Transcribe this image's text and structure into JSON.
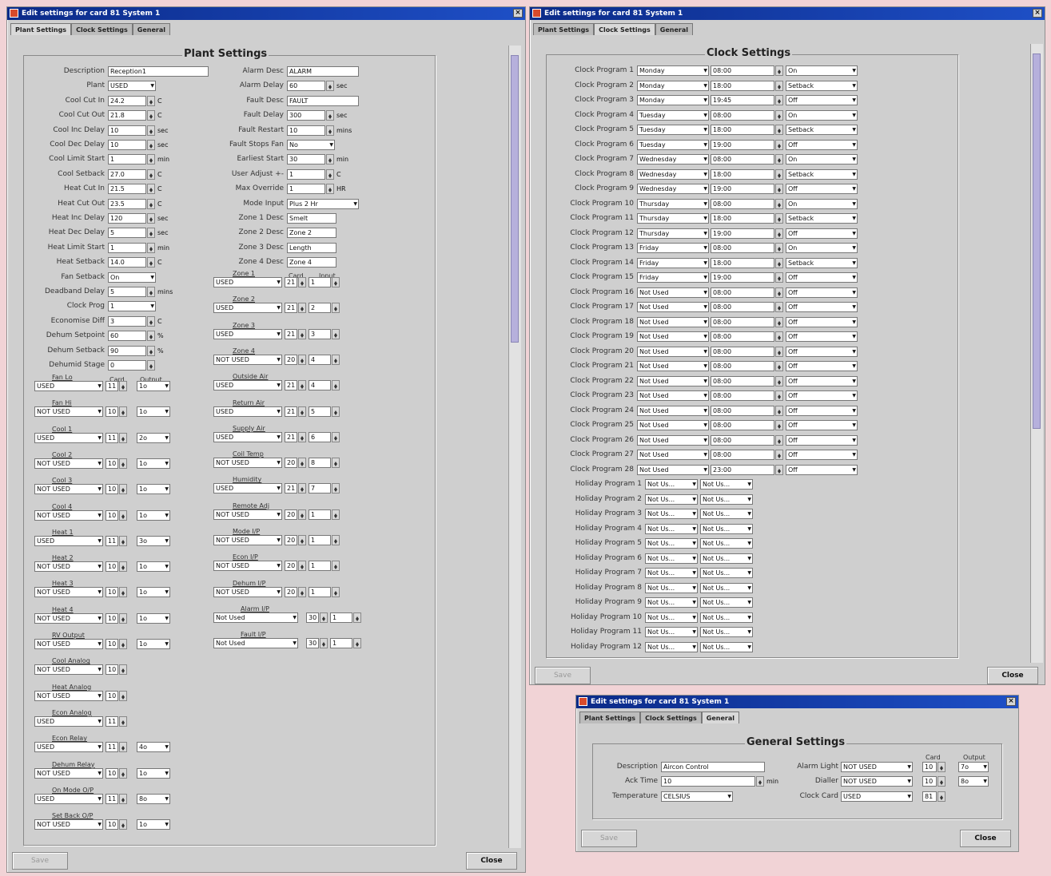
{
  "win1": {
    "title": "Edit settings for card 81 System 1",
    "tabs": [
      "Plant Settings",
      "Clock Settings",
      "General"
    ],
    "panel": "Plant Settings",
    "left": [
      {
        "label": "Description",
        "value": "Reception1",
        "type": "text",
        "w": 126
      },
      {
        "label": "Plant",
        "value": "USED",
        "type": "sel",
        "w": 60
      },
      {
        "label": "Cool Cut In",
        "value": "24.2",
        "type": "spin",
        "w": 48,
        "unit": "C"
      },
      {
        "label": "Cool Cut Out",
        "value": "21.8",
        "type": "spin",
        "w": 48,
        "unit": "C"
      },
      {
        "label": "Cool Inc Delay",
        "value": "10",
        "type": "spin",
        "w": 48,
        "unit": "sec"
      },
      {
        "label": "Cool Dec Delay",
        "value": "10",
        "type": "spin",
        "w": 48,
        "unit": "sec"
      },
      {
        "label": "Cool Limit Start",
        "value": "1",
        "type": "spin",
        "w": 48,
        "unit": "min"
      },
      {
        "label": "Cool Setback",
        "value": "27.0",
        "type": "spin",
        "w": 48,
        "unit": "C"
      },
      {
        "label": "Heat Cut In",
        "value": "21.5",
        "type": "spin",
        "w": 48,
        "unit": "C"
      },
      {
        "label": "Heat Cut Out",
        "value": "23.5",
        "type": "spin",
        "w": 48,
        "unit": "C"
      },
      {
        "label": "Heat Inc Delay",
        "value": "120",
        "type": "spin",
        "w": 48,
        "unit": "sec"
      },
      {
        "label": "Heat Dec Delay",
        "value": "5",
        "type": "spin",
        "w": 48,
        "unit": "sec"
      },
      {
        "label": "Heat Limit Start",
        "value": "1",
        "type": "spin",
        "w": 48,
        "unit": "min"
      },
      {
        "label": "Heat Setback",
        "value": "14.0",
        "type": "spin",
        "w": 48,
        "unit": "C"
      },
      {
        "label": "Fan Setback",
        "value": "On",
        "type": "sel",
        "w": 60
      },
      {
        "label": "Deadband Delay",
        "value": "5",
        "type": "spin",
        "w": 48,
        "unit": "mins"
      },
      {
        "label": "Clock Prog",
        "value": "1",
        "type": "sel",
        "w": 60
      },
      {
        "label": "Economise Diff",
        "value": "3",
        "type": "spin",
        "w": 48,
        "unit": "C"
      },
      {
        "label": "Dehum Setpoint",
        "value": "60",
        "type": "spin",
        "w": 48,
        "unit": "%"
      },
      {
        "label": "Dehum Setback",
        "value": "90",
        "type": "spin",
        "w": 48,
        "unit": "%"
      },
      {
        "label": "Dehumid Stage",
        "value": "0",
        "type": "spin",
        "w": 48,
        "unit": ""
      }
    ],
    "right": [
      {
        "label": "Alarm Desc",
        "value": "ALARM",
        "type": "text",
        "w": 90
      },
      {
        "label": "Alarm Delay",
        "value": "60",
        "type": "spin",
        "w": 48,
        "unit": "sec"
      },
      {
        "label": "Fault Desc",
        "value": "FAULT",
        "type": "text",
        "w": 90
      },
      {
        "label": "Fault Delay",
        "value": "300",
        "type": "spin",
        "w": 48,
        "unit": "sec"
      },
      {
        "label": "Fault Restart",
        "value": "10",
        "type": "spin",
        "w": 48,
        "unit": "mins"
      },
      {
        "label": "Fault Stops Fan",
        "value": "No",
        "type": "sel",
        "w": 60
      },
      {
        "label": "Earliest Start",
        "value": "30",
        "type": "spin",
        "w": 48,
        "unit": "min"
      },
      {
        "label": "User Adjust +-",
        "value": "1",
        "type": "spin",
        "w": 48,
        "unit": "C"
      },
      {
        "label": "Max Override",
        "value": "1",
        "type": "spin",
        "w": 48,
        "unit": "HR"
      },
      {
        "label": "Mode Input",
        "value": "Plus 2 Hr",
        "type": "sel",
        "w": 90
      },
      {
        "label": "Zone 1 Desc",
        "value": "Smelt",
        "type": "text",
        "w": 62
      },
      {
        "label": "Zone 2 Desc",
        "value": "Zone 2",
        "type": "text",
        "w": 62
      },
      {
        "label": "Zone 3 Desc",
        "value": "Length",
        "type": "text",
        "w": 62
      },
      {
        "label": "Zone 4 Desc",
        "value": "Zone 4",
        "type": "text",
        "w": 62
      }
    ],
    "io_header": {
      "card": "Card",
      "output": "Output",
      "input": "Input"
    },
    "outputs": [
      {
        "label": "Fan Lo",
        "used": "USED",
        "card": "11",
        "out": "1o"
      },
      {
        "label": "Fan Hi",
        "used": "NOT USED",
        "card": "10",
        "out": "1o"
      },
      {
        "label": "Cool 1",
        "used": "USED",
        "card": "11",
        "out": "2o"
      },
      {
        "label": "Cool 2",
        "used": "NOT USED",
        "card": "10",
        "out": "1o"
      },
      {
        "label": "Cool 3",
        "used": "NOT USED",
        "card": "10",
        "out": "1o"
      },
      {
        "label": "Cool 4",
        "used": "NOT USED",
        "card": "10",
        "out": "1o"
      },
      {
        "label": "Heat 1",
        "used": "USED",
        "card": "11",
        "out": "3o"
      },
      {
        "label": "Heat 2",
        "used": "NOT USED",
        "card": "10",
        "out": "1o"
      },
      {
        "label": "Heat 3",
        "used": "NOT USED",
        "card": "10",
        "out": "1o"
      },
      {
        "label": "Heat 4",
        "used": "NOT USED",
        "card": "10",
        "out": "1o"
      },
      {
        "label": "RV Output",
        "used": "NOT USED",
        "card": "10",
        "out": "1o"
      },
      {
        "label": "Cool Analog",
        "used": "NOT USED",
        "card": "10",
        "out": ""
      },
      {
        "label": "Heat Analog",
        "used": "NOT USED",
        "card": "10",
        "out": ""
      },
      {
        "label": "Econ Analog",
        "used": "USED",
        "card": "11",
        "out": ""
      },
      {
        "label": "Econ Relay",
        "used": "USED",
        "card": "11",
        "out": "4o"
      },
      {
        "label": "Dehum Relay",
        "used": "NOT USED",
        "card": "10",
        "out": "1o"
      },
      {
        "label": "On Mode O/P",
        "used": "USED",
        "card": "11",
        "out": "8o"
      },
      {
        "label": "Set Back O/P",
        "used": "NOT USED",
        "card": "10",
        "out": "1o"
      }
    ],
    "inputs": [
      {
        "label": "Zone 1",
        "used": "USED",
        "card": "21",
        "in": "1"
      },
      {
        "label": "Zone 2",
        "used": "USED",
        "card": "21",
        "in": "2"
      },
      {
        "label": "Zone 3",
        "used": "USED",
        "card": "21",
        "in": "3"
      },
      {
        "label": "Zone 4",
        "used": "NOT USED",
        "card": "20",
        "in": "4"
      },
      {
        "label": "Outside Air",
        "used": "USED",
        "card": "21",
        "in": "4"
      },
      {
        "label": "Return Air",
        "used": "USED",
        "card": "21",
        "in": "5"
      },
      {
        "label": "Supply Air",
        "used": "USED",
        "card": "21",
        "in": "6"
      },
      {
        "label": "Coil Temp",
        "used": "NOT USED",
        "card": "20",
        "in": "8"
      },
      {
        "label": "Humidity",
        "used": "USED",
        "card": "21",
        "in": "7"
      },
      {
        "label": "Remote Adj",
        "used": "NOT USED",
        "card": "20",
        "in": "1"
      },
      {
        "label": "Mode I/P",
        "used": "NOT USED",
        "card": "20",
        "in": "1"
      },
      {
        "label": "Econ I/P",
        "used": "NOT USED",
        "card": "20",
        "in": "1"
      },
      {
        "label": "Dehum I/P",
        "used": "NOT USED",
        "card": "20",
        "in": "1"
      },
      {
        "label": "Alarm I/P",
        "used": "Not Used",
        "card": "30",
        "in": "1"
      },
      {
        "label": "Fault I/P",
        "used": "Not Used",
        "card": "30",
        "in": "1"
      }
    ],
    "save": "Save",
    "close": "Close"
  },
  "win2": {
    "title": "Edit settings for card 81 System 1",
    "tabs": [
      "Plant Settings",
      "Clock Settings",
      "General"
    ],
    "panel": "Clock Settings",
    "clock": [
      [
        "Clock Program 1",
        "Monday",
        "08:00",
        "On"
      ],
      [
        "Clock Program 2",
        "Monday",
        "18:00",
        "Setback"
      ],
      [
        "Clock Program 3",
        "Monday",
        "19:45",
        "Off"
      ],
      [
        "Clock Program 4",
        "Tuesday",
        "08:00",
        "On"
      ],
      [
        "Clock Program 5",
        "Tuesday",
        "18:00",
        "Setback"
      ],
      [
        "Clock Program 6",
        "Tuesday",
        "19:00",
        "Off"
      ],
      [
        "Clock Program 7",
        "Wednesday",
        "08:00",
        "On"
      ],
      [
        "Clock Program 8",
        "Wednesday",
        "18:00",
        "Setback"
      ],
      [
        "Clock Program 9",
        "Wednesday",
        "19:00",
        "Off"
      ],
      [
        "Clock Program 10",
        "Thursday",
        "08:00",
        "On"
      ],
      [
        "Clock Program 11",
        "Thursday",
        "18:00",
        "Setback"
      ],
      [
        "Clock Program 12",
        "Thursday",
        "19:00",
        "Off"
      ],
      [
        "Clock Program 13",
        "Friday",
        "08:00",
        "On"
      ],
      [
        "Clock Program 14",
        "Friday",
        "18:00",
        "Setback"
      ],
      [
        "Clock Program 15",
        "Friday",
        "19:00",
        "Off"
      ],
      [
        "Clock Program 16",
        "Not Used",
        "08:00",
        "Off"
      ],
      [
        "Clock Program 17",
        "Not Used",
        "08:00",
        "Off"
      ],
      [
        "Clock Program 18",
        "Not Used",
        "08:00",
        "Off"
      ],
      [
        "Clock Program 19",
        "Not Used",
        "08:00",
        "Off"
      ],
      [
        "Clock Program 20",
        "Not Used",
        "08:00",
        "Off"
      ],
      [
        "Clock Program 21",
        "Not Used",
        "08:00",
        "Off"
      ],
      [
        "Clock Program 22",
        "Not Used",
        "08:00",
        "Off"
      ],
      [
        "Clock Program 23",
        "Not Used",
        "08:00",
        "Off"
      ],
      [
        "Clock Program 24",
        "Not Used",
        "08:00",
        "Off"
      ],
      [
        "Clock Program 25",
        "Not Used",
        "08:00",
        "Off"
      ],
      [
        "Clock Program 26",
        "Not Used",
        "08:00",
        "Off"
      ],
      [
        "Clock Program 27",
        "Not Used",
        "08:00",
        "Off"
      ],
      [
        "Clock Program 28",
        "Not Used",
        "23:00",
        "Off"
      ]
    ],
    "holiday": [
      [
        "Holiday Program 1",
        "Not Us...",
        "Not Us..."
      ],
      [
        "Holiday Program 2",
        "Not Us...",
        "Not Us..."
      ],
      [
        "Holiday Program 3",
        "Not Us...",
        "Not Us..."
      ],
      [
        "Holiday Program 4",
        "Not Us...",
        "Not Us..."
      ],
      [
        "Holiday Program 5",
        "Not Us...",
        "Not Us..."
      ],
      [
        "Holiday Program 6",
        "Not Us...",
        "Not Us..."
      ],
      [
        "Holiday Program 7",
        "Not Us...",
        "Not Us..."
      ],
      [
        "Holiday Program 8",
        "Not Us...",
        "Not Us..."
      ],
      [
        "Holiday Program 9",
        "Not Us...",
        "Not Us..."
      ],
      [
        "Holiday Program 10",
        "Not Us...",
        "Not Us..."
      ],
      [
        "Holiday Program 11",
        "Not Us...",
        "Not Us..."
      ],
      [
        "Holiday Program 12",
        "Not Us...",
        "Not Us..."
      ]
    ],
    "save": "Save",
    "close": "Close"
  },
  "win3": {
    "title": "Edit settings for card 81 System 1",
    "tabs": [
      "Plant Settings",
      "Clock Settings",
      "General"
    ],
    "panel": "General Settings",
    "description_label": "Description",
    "description": "Aircon Control",
    "acktime_label": "Ack Time",
    "acktime": "10",
    "acktime_unit": "min",
    "temperature_label": "Temperature",
    "temperature": "CELSIUS",
    "card_label": "Card",
    "output_label": "Output",
    "alarm_light_label": "Alarm Light",
    "alarm_light": "NOT USED",
    "alarm_light_card": "10",
    "alarm_light_out": "7o",
    "dialler_label": "Dialler",
    "dialler": "NOT USED",
    "dialler_card": "10",
    "dialler_out": "8o",
    "clock_card_label": "Clock Card",
    "clock_card": "USED",
    "clock_card_card": "81",
    "save": "Save",
    "close": "Close"
  },
  "colors": {
    "titlebar": "#1e4fc6",
    "background": "#f1d3d6",
    "panel": "#cfcfcf",
    "thumb": "#b6b0dc"
  }
}
